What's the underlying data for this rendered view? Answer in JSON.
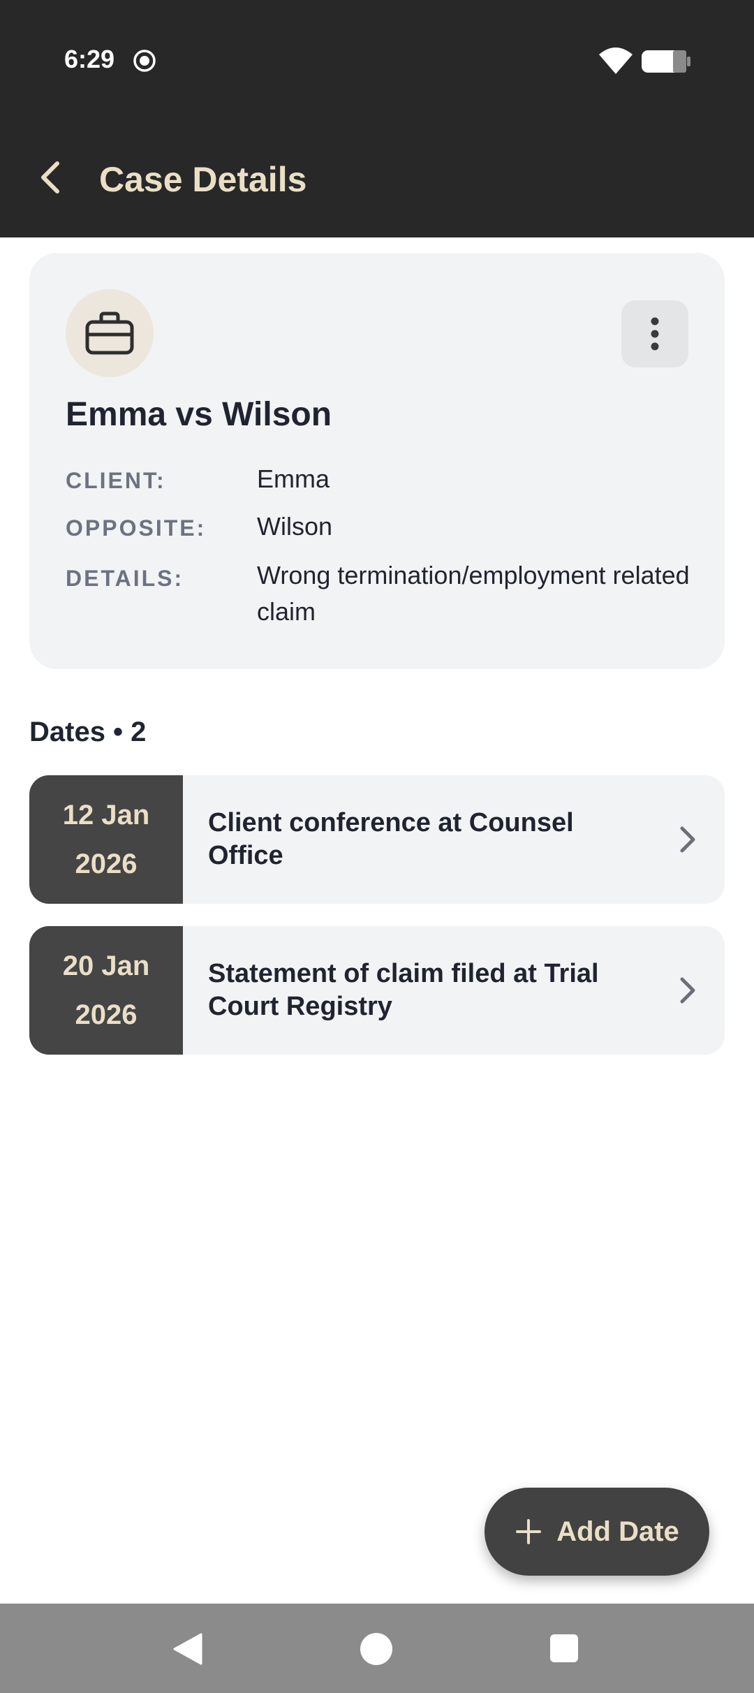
{
  "status_bar": {
    "time": "6:29",
    "icons": [
      "screen-record-icon",
      "wifi-icon",
      "battery-icon"
    ]
  },
  "app_bar": {
    "title": "Case Details",
    "back_icon": "chevron-left-icon"
  },
  "case": {
    "icon": "briefcase-icon",
    "title": "Emma vs Wilson",
    "fields": [
      {
        "label": "CLIENT:",
        "value": "Emma"
      },
      {
        "label": "OPPOSITE:",
        "value": "Wilson"
      },
      {
        "label": "DETAILS:",
        "value": "Wrong termination/employment related claim"
      }
    ]
  },
  "dates_section": {
    "heading": "Dates • 2",
    "items": [
      {
        "day_month": "12 Jan",
        "year": "2026",
        "title": "Client conference at Counsel Office"
      },
      {
        "day_month": "20 Jan",
        "year": "2026",
        "title": "Statement of claim filed at Trial Court Registry"
      }
    ]
  },
  "fab": {
    "label": "Add Date",
    "icon": "plus-icon"
  },
  "colors": {
    "header_bg": "#282828",
    "accent_text": "#eadfc6",
    "card_bg": "#f2f3f5",
    "date_block_bg": "#454545",
    "fab_bg": "#424242"
  }
}
